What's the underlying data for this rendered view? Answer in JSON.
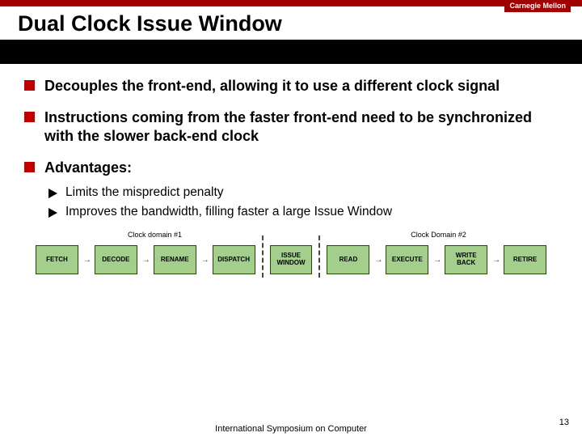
{
  "brand": "Carnegie Mellon",
  "title": "Dual Clock Issue Window",
  "bullets": [
    "Decouples the front-end, allowing it to use a different clock signal",
    "Instructions coming from the faster front-end need to be synchronized with the slower back-end clock",
    "Advantages:"
  ],
  "sub_bullets": [
    "Limits the mispredict penalty",
    "Improves the bandwidth, filling faster a large Issue Window"
  ],
  "diagram": {
    "domain_left": "Clock domain #1",
    "domain_right": "Clock Domain #2",
    "stages_left": [
      "FETCH",
      "DECODE",
      "RENAME",
      "DISPATCH"
    ],
    "center": "ISSUE WINDOW",
    "stages_right": [
      "READ",
      "EXECUTE",
      "WRITE BACK",
      "RETIRE"
    ]
  },
  "footer": "International Symposium on Computer",
  "page_number": "13"
}
